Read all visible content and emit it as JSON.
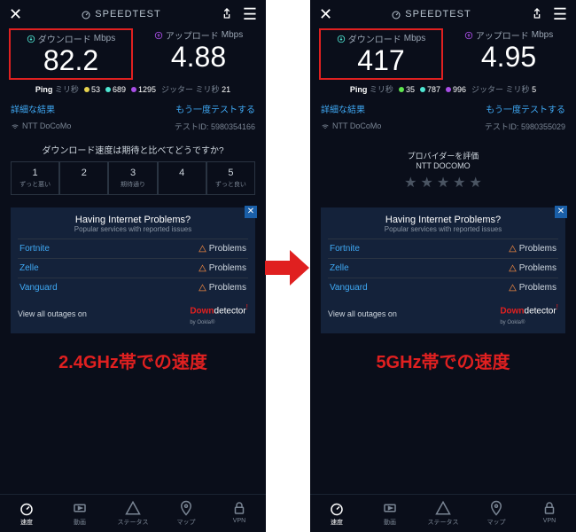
{
  "brand": "SPEEDTEST",
  "panels": [
    {
      "download_label": "ダウンロード",
      "upload_label": "アップロード",
      "unit": "Mbps",
      "download": "82.2",
      "upload": "4.88",
      "ping_label": "Ping",
      "ping_unit": "ミリ秒",
      "ping_idle": "53",
      "ping_down": "689",
      "ping_up": "1295",
      "jitter_label": "ジッター",
      "jitter_unit": "ミリ秒",
      "jitter": "21",
      "detail": "詳細な結果",
      "retest": "もう一度テストする",
      "isp": "NTT DoCoMo",
      "test_id_label": "テストID:",
      "test_id": "5980354166",
      "survey_q": "ダウンロード速度は期待と比べてどうですか?",
      "ratings": [
        {
          "n": "1",
          "l": "ずっと悪い"
        },
        {
          "n": "2",
          "l": ""
        },
        {
          "n": "3",
          "l": "期待通り"
        },
        {
          "n": "4",
          "l": ""
        },
        {
          "n": "5",
          "l": "ずっと良い"
        }
      ],
      "caption": "2.4GHz帯での速度"
    },
    {
      "download_label": "ダウンロード",
      "upload_label": "アップロード",
      "unit": "Mbps",
      "download": "417",
      "upload": "4.95",
      "ping_label": "Ping",
      "ping_unit": "ミリ秒",
      "ping_idle": "35",
      "ping_down": "787",
      "ping_up": "996",
      "jitter_label": "ジッター",
      "jitter_unit": "ミリ秒",
      "jitter": "5",
      "detail": "詳細な結果",
      "retest": "もう一度テストする",
      "isp": "NTT DoCoMo",
      "test_id_label": "テストID:",
      "test_id": "5980355029",
      "provider_eval_label": "プロバイダーを評価",
      "provider_name": "NTT DOCOMO",
      "caption": "5GHz帯での速度"
    }
  ],
  "ad": {
    "title": "Having Internet Problems?",
    "sub": "Popular services with reported issues",
    "services": [
      {
        "name": "Fortnite",
        "status": "Problems"
      },
      {
        "name": "Zelle",
        "status": "Problems"
      },
      {
        "name": "Vanguard",
        "status": "Problems"
      }
    ],
    "view_all": "View all outages on",
    "dd_down": "Down",
    "dd_det": "detector",
    "dd_sub": "by Ookla®"
  },
  "nav": [
    {
      "id": "speed",
      "label": "速度"
    },
    {
      "id": "video",
      "label": "動画"
    },
    {
      "id": "status",
      "label": "ステータス"
    },
    {
      "id": "map",
      "label": "マップ"
    },
    {
      "id": "vpn",
      "label": "VPN"
    }
  ]
}
